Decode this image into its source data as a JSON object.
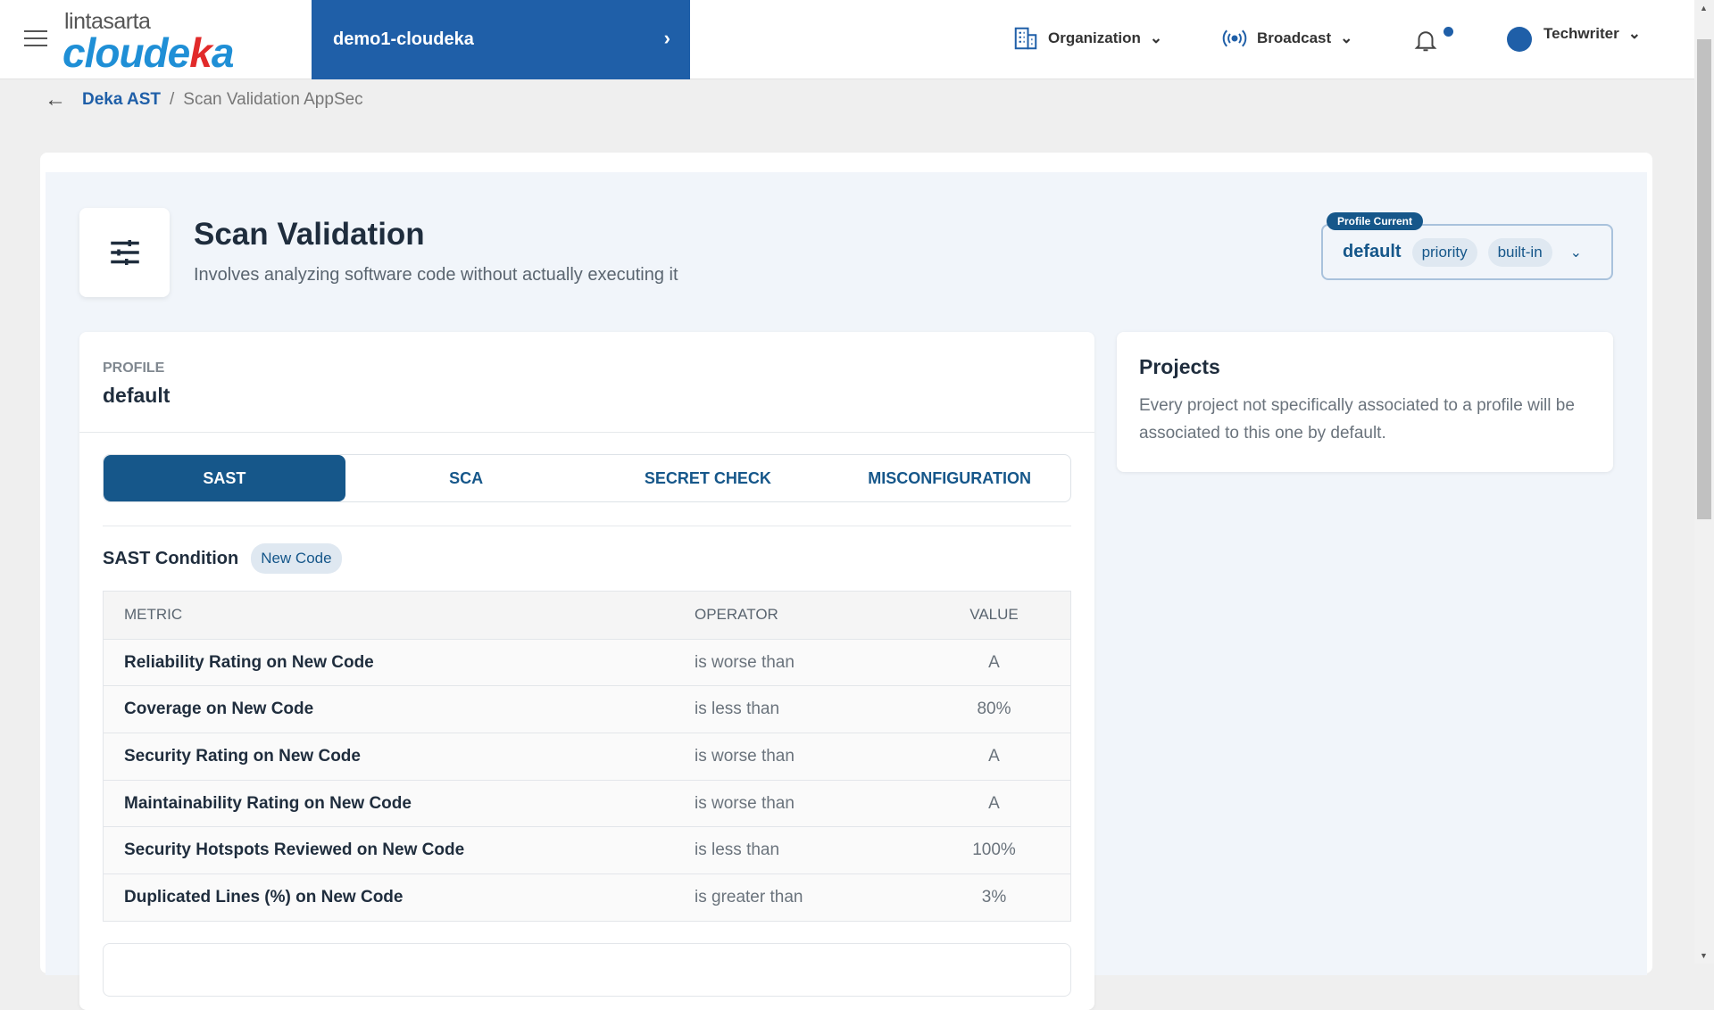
{
  "header": {
    "logo_top": "lintasarta",
    "logo_main_a": "cloude",
    "logo_main_b": "k",
    "logo_main_c": "a",
    "project": "demo1-cloudeka",
    "organization": "Organization",
    "broadcast": "Broadcast",
    "user": "Techwriter"
  },
  "breadcrumb": {
    "parent": "Deka AST",
    "separator": "/",
    "current": "Scan Validation AppSec"
  },
  "page": {
    "title": "Scan Validation",
    "subtitle": "Involves analyzing software code without actually executing it"
  },
  "profile_current": {
    "label": "Profile Current",
    "value": "default",
    "chips": [
      "priority",
      "built-in"
    ]
  },
  "profile": {
    "label": "PROFILE",
    "value": "default"
  },
  "tabs": [
    "SAST",
    "SCA",
    "SECRET CHECK",
    "MISCONFIGURATION"
  ],
  "condition": {
    "title": "SAST Condition",
    "badge": "New Code"
  },
  "table": {
    "headers": [
      "METRIC",
      "OPERATOR",
      "VALUE"
    ],
    "rows": [
      [
        "Reliability Rating on New Code",
        "is worse than",
        "A"
      ],
      [
        "Coverage on New Code",
        "is less than",
        "80%"
      ],
      [
        "Security Rating on New Code",
        "is worse than",
        "A"
      ],
      [
        "Maintainability Rating on New Code",
        "is worse than",
        "A"
      ],
      [
        "Security Hotspots Reviewed on New Code",
        "is less than",
        "100%"
      ],
      [
        "Duplicated Lines (%) on New Code",
        "is greater than",
        "3%"
      ]
    ]
  },
  "projects": {
    "title": "Projects",
    "description": "Every project not specifically associated to a profile will be associated to this one by default."
  }
}
